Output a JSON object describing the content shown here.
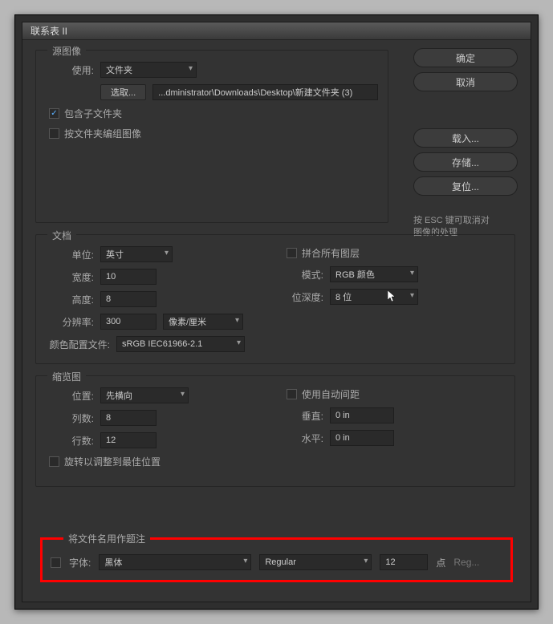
{
  "title": "联系表 II",
  "buttons": {
    "ok": "确定",
    "cancel": "取消",
    "load": "载入...",
    "save": "存储...",
    "reset": "复位..."
  },
  "hint": "按 ESC 键可取消对\n图像的处理",
  "source": {
    "legend": "源图像",
    "use_label": "使用:",
    "use_value": "文件夹",
    "browse": "选取...",
    "path": "...dministrator\\Downloads\\Desktop\\新建文件夹 (3)",
    "include_sub": "包含子文件夹",
    "group_by_folder": "按文件夹编组图像"
  },
  "document": {
    "legend": "文档",
    "unit_label": "单位:",
    "unit_value": "英寸",
    "width_label": "宽度:",
    "width_value": "10",
    "height_label": "高度:",
    "height_value": "8",
    "res_label": "分辨率:",
    "res_value": "300",
    "res_unit": "像素/厘米",
    "profile_label": "颜色配置文件:",
    "profile_value": "sRGB IEC61966-2.1",
    "flatten": "拼合所有图层",
    "mode_label": "模式:",
    "mode_value": "RGB 颜色",
    "depth_label": "位深度:",
    "depth_value": "8 位"
  },
  "thumb": {
    "legend": "缩览图",
    "place_label": "位置:",
    "place_value": "先横向",
    "cols_label": "列数:",
    "cols_value": "8",
    "rows_label": "行数:",
    "rows_value": "12",
    "auto_space": "使用自动间距",
    "vert_label": "垂直:",
    "vert_value": "0 in",
    "horz_label": "水平:",
    "horz_value": "0 in",
    "rotate_fit": "旋转以调整到最佳位置"
  },
  "caption": {
    "legend": "将文件名用作题注",
    "font_label": "字体:",
    "font_value": "黑体",
    "style_value": "Regular",
    "size_value": "12",
    "size_unit": "点",
    "extra": "Reg..."
  }
}
